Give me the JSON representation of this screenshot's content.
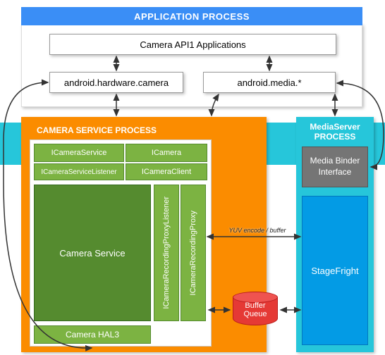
{
  "app_process": {
    "title": "APPLICATION PROCESS",
    "camera_api": "Camera API1 Applications",
    "hw_camera": "android.hardware.camera",
    "media": "android.media.*"
  },
  "camera_service_process": {
    "title": "CAMERA SERVICE PROCESS",
    "icamera_service": "ICameraService",
    "icamera": "ICamera",
    "icamera_service_listener": "ICameraServiceListener",
    "icamera_client": "ICameraClient",
    "recording_proxy_listener": "ICameraRecordingProxyListener",
    "recording_proxy": "ICameraRecordingProxy",
    "camera_service": "Camera Service",
    "camera_hal3": "Camera HAL3"
  },
  "mediaserver_process": {
    "title": "MediaServer PROCESS",
    "binder_interface": "Media Binder Interface",
    "stagefright": "StageFright"
  },
  "buffer_queue": "Buffer Queue",
  "encode_label": "YUV encode / buffer"
}
